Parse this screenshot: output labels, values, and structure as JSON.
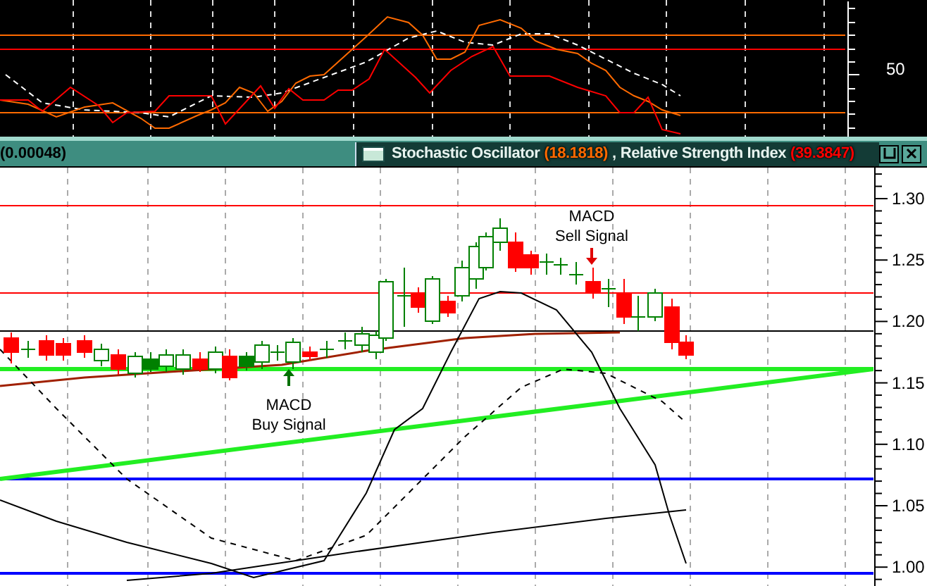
{
  "top_panel": {
    "axis_label": "50"
  },
  "header": {
    "value": "(0.00048)",
    "separator": ",",
    "indicators": [
      {
        "name": "Stochastic Oscillator",
        "value": "(18.1818)",
        "color": "#ff6a00"
      },
      {
        "name": "Relative Strength Index",
        "value": "(39.3847)",
        "color": "#ff0000"
      }
    ]
  },
  "price_panel": {
    "axis_labels": [
      "1.30",
      "1.25",
      "1.20",
      "1.15",
      "1.10",
      "1.05",
      "1.00"
    ],
    "annotations": [
      {
        "kind": "buy",
        "lines": [
          "MACD",
          "Buy Signal"
        ]
      },
      {
        "kind": "sell",
        "lines": [
          "MACD",
          "Sell Signal"
        ]
      }
    ]
  }
}
